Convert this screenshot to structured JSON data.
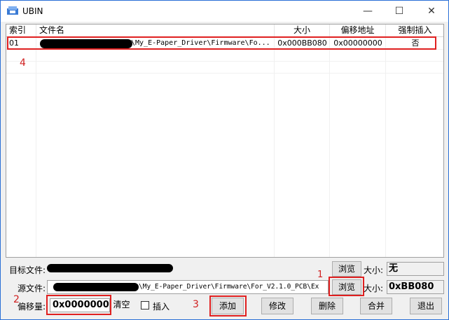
{
  "window": {
    "title": "UBIN"
  },
  "columns": [
    "索引",
    "文件名",
    "大小",
    "偏移地址",
    "强制插入"
  ],
  "rows": [
    {
      "index": "01",
      "filename": "\\My_E-Paper_Driver\\Firmware\\Fo...",
      "size": "0x000BB080",
      "offset": "0x00000000",
      "force": "否"
    }
  ],
  "target": {
    "label": "目标文件:",
    "value": "",
    "browse": "浏览",
    "size_label": "大小:",
    "size_value": "无"
  },
  "source": {
    "label": "源文件:",
    "value": "\\My_E-Paper_Driver\\Firmware\\For_V2.1.0_PCB\\Ex",
    "browse": "浏览",
    "size_label": "大小:",
    "size_value": "0xBB080"
  },
  "offset": {
    "label": "偏移量:",
    "value": "0x00000000",
    "clear": "清空"
  },
  "insert": {
    "label": "插入",
    "checked": false
  },
  "buttons": {
    "add": "添加",
    "modify": "修改",
    "delete": "删除",
    "merge": "合并",
    "exit": "退出"
  },
  "annotations": {
    "n1": "1",
    "n2": "2",
    "n3": "3",
    "n4": "4"
  },
  "icons": {
    "min": "minimize-icon",
    "max": "maximize-icon",
    "close": "close-icon"
  }
}
